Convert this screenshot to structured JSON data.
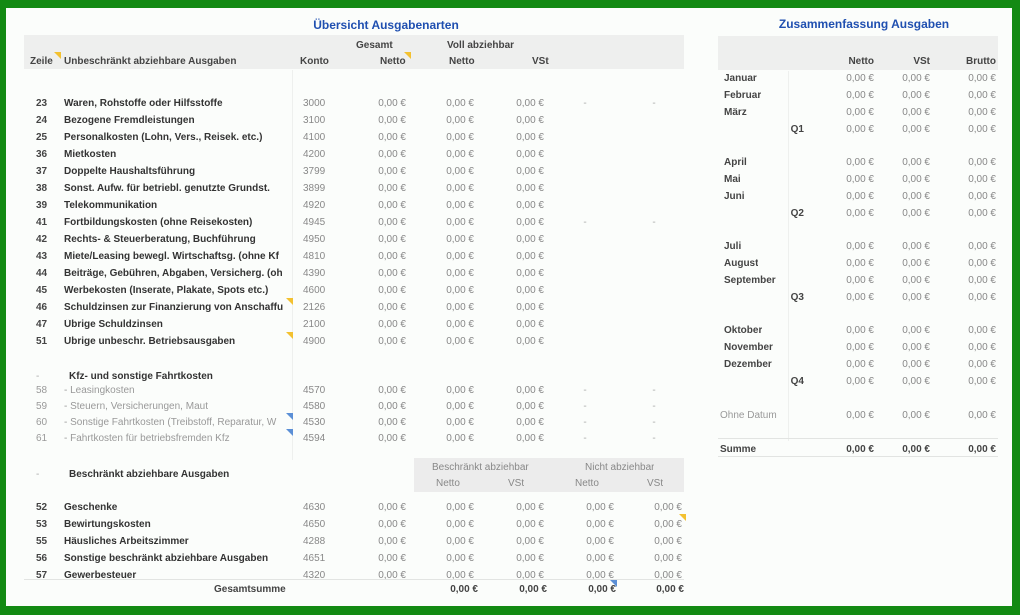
{
  "left": {
    "title": "Übersicht Ausgabenarten",
    "headers": {
      "zeile": "Zeile",
      "category": "Unbeschränkt abziehbare Ausgaben",
      "konto": "Konto",
      "gesamt": "Gesamt",
      "gesamt_netto": "Netto",
      "voll": "Voll abziehbar",
      "voll_netto": "Netto",
      "voll_vst": "VSt"
    },
    "unbeschraenkt_rows": [
      {
        "zeile": "23",
        "label": "Waren, Rohstoffe oder Hilfsstoffe",
        "konto": "3000",
        "gesamt": "0,00 €",
        "netto": "0,00 €",
        "vst": "0,00 €",
        "d1": "-",
        "d2": "-"
      },
      {
        "zeile": "24",
        "label": "Bezogene Fremdleistungen",
        "konto": "3100",
        "gesamt": "0,00 €",
        "netto": "0,00 €",
        "vst": "0,00 €",
        "d1": "",
        "d2": ""
      },
      {
        "zeile": "25",
        "label": "Personalkosten (Lohn, Vers., Reisek. etc.)",
        "konto": "4100",
        "gesamt": "0,00 €",
        "netto": "0,00 €",
        "vst": "0,00 €",
        "d1": "",
        "d2": ""
      },
      {
        "zeile": "36",
        "label": "Mietkosten",
        "konto": "4200",
        "gesamt": "0,00 €",
        "netto": "0,00 €",
        "vst": "0,00 €",
        "d1": "",
        "d2": ""
      },
      {
        "zeile": "37",
        "label": "Doppelte Haushaltsführung",
        "konto": "3799",
        "gesamt": "0,00 €",
        "netto": "0,00 €",
        "vst": "0,00 €",
        "d1": "",
        "d2": ""
      },
      {
        "zeile": "38",
        "label": "Sonst. Aufw. für betriebl. genutzte Grundst.",
        "konto": "3899",
        "gesamt": "0,00 €",
        "netto": "0,00 €",
        "vst": "0,00 €",
        "d1": "",
        "d2": ""
      },
      {
        "zeile": "39",
        "label": "Telekommunikation",
        "konto": "4920",
        "gesamt": "0,00 €",
        "netto": "0,00 €",
        "vst": "0,00 €",
        "d1": "",
        "d2": ""
      },
      {
        "zeile": "41",
        "label": "Fortbildungskosten (ohne Reisekosten)",
        "konto": "4945",
        "gesamt": "0,00 €",
        "netto": "0,00 €",
        "vst": "0,00 €",
        "d1": "-",
        "d2": "-"
      },
      {
        "zeile": "42",
        "label": "Rechts- & Steuerberatung, Buchführung",
        "konto": "4950",
        "gesamt": "0,00 €",
        "netto": "0,00 €",
        "vst": "0,00 €",
        "d1": "",
        "d2": ""
      },
      {
        "zeile": "43",
        "label": "Miete/Leasing bewegl. Wirtschaftsg. (ohne Kf",
        "konto": "4810",
        "gesamt": "0,00 €",
        "netto": "0,00 €",
        "vst": "0,00 €",
        "d1": "",
        "d2": ""
      },
      {
        "zeile": "44",
        "label": "Beiträge, Gebühren, Abgaben, Versicherg. (oh",
        "konto": "4390",
        "gesamt": "0,00 €",
        "netto": "0,00 €",
        "vst": "0,00 €",
        "d1": "",
        "d2": ""
      },
      {
        "zeile": "45",
        "label": "Werbekosten (Inserate, Plakate, Spots etc.)",
        "konto": "4600",
        "gesamt": "0,00 €",
        "netto": "0,00 €",
        "vst": "0,00 €",
        "d1": "",
        "d2": ""
      },
      {
        "zeile": "46",
        "label": "Schuldzinsen zur Finanzierung von Anschaffu",
        "konto": "2126",
        "gesamt": "0,00 €",
        "netto": "0,00 €",
        "vst": "0,00 €",
        "d1": "",
        "d2": ""
      },
      {
        "zeile": "47",
        "label": "Übrige Schuldzinsen",
        "konto": "2100",
        "gesamt": "0,00 €",
        "netto": "0,00 €",
        "vst": "0,00 €",
        "d1": "",
        "d2": ""
      },
      {
        "zeile": "51",
        "label": "Übrige unbeschr. Betriebsausgaben",
        "konto": "4900",
        "gesamt": "0,00 €",
        "netto": "0,00 €",
        "vst": "0,00 €",
        "d1": "",
        "d2": ""
      }
    ],
    "kfz_section": {
      "marker": "-",
      "label": "Kfz- und sonstige Fahrtkosten",
      "rows": [
        {
          "zeile": "58",
          "label": "- Leasingkosten",
          "konto": "4570",
          "gesamt": "0,00 €",
          "netto": "0,00 €",
          "vst": "0,00 €",
          "d1": "-",
          "d2": "-"
        },
        {
          "zeile": "59",
          "label": "- Steuern, Versicherungen, Maut",
          "konto": "4580",
          "gesamt": "0,00 €",
          "netto": "0,00 €",
          "vst": "0,00 €",
          "d1": "-",
          "d2": "-"
        },
        {
          "zeile": "60",
          "label": "- Sonstige Fahrtkosten (Treibstoff, Reparatur, W",
          "konto": "4530",
          "gesamt": "0,00 €",
          "netto": "0,00 €",
          "vst": "0,00 €",
          "d1": "-",
          "d2": "-"
        },
        {
          "zeile": "61",
          "label": "- Fahrtkosten für betriebsfremden Kfz",
          "konto": "4594",
          "gesamt": "0,00 €",
          "netto": "0,00 €",
          "vst": "0,00 €",
          "d1": "-",
          "d2": "-"
        }
      ]
    },
    "beschraenkt_section": {
      "marker": "-",
      "label": "Beschränkt abziehbare Ausgaben",
      "group1": "Beschränkt abziehbar",
      "group2": "Nicht abziehbar",
      "sub_netto1": "Netto",
      "sub_vst1": "VSt",
      "sub_netto2": "Netto",
      "sub_vst2": "VSt",
      "rows": [
        {
          "zeile": "52",
          "label": "Geschenke",
          "konto": "4630",
          "gesamt": "0,00 €",
          "b_netto": "0,00 €",
          "b_vst": "0,00 €",
          "n_netto": "0,00 €",
          "n_vst": "0,00 €"
        },
        {
          "zeile": "53",
          "label": "Bewirtungskosten",
          "konto": "4650",
          "gesamt": "0,00 €",
          "b_netto": "0,00 €",
          "b_vst": "0,00 €",
          "n_netto": "0,00 €",
          "n_vst": "0,00 €"
        },
        {
          "zeile": "55",
          "label": "Häusliches Arbeitszimmer",
          "konto": "4288",
          "gesamt": "0,00 €",
          "b_netto": "0,00 €",
          "b_vst": "0,00 €",
          "n_netto": "0,00 €",
          "n_vst": "0,00 €"
        },
        {
          "zeile": "56",
          "label": "Sonstige beschränkt abziehbare Ausgaben",
          "konto": "4651",
          "gesamt": "0,00 €",
          "b_netto": "0,00 €",
          "b_vst": "0,00 €",
          "n_netto": "0,00 €",
          "n_vst": "0,00 €"
        },
        {
          "zeile": "57",
          "label": "Gewerbesteuer",
          "konto": "4320",
          "gesamt": "0,00 €",
          "b_netto": "0,00 €",
          "b_vst": "0,00 €",
          "n_netto": "0,00 €",
          "n_vst": "0,00 €"
        }
      ]
    },
    "gesamtsumme": {
      "label": "Gesamtsumme",
      "b_netto": "0,00 €",
      "b_vst": "0,00 €",
      "n_netto": "0,00 €",
      "n_vst": "0,00 €"
    }
  },
  "right": {
    "title": "Zusammenfassung Ausgaben",
    "headers": {
      "netto": "Netto",
      "vst": "VSt",
      "brutto": "Brutto"
    },
    "groups": [
      {
        "months": [
          {
            "label": "Januar",
            "netto": "0,00 €",
            "vst": "0,00 €",
            "brutto": "0,00 €"
          },
          {
            "label": "Februar",
            "netto": "0,00 €",
            "vst": "0,00 €",
            "brutto": "0,00 €"
          },
          {
            "label": "März",
            "netto": "0,00 €",
            "vst": "0,00 €",
            "brutto": "0,00 €"
          }
        ],
        "quarter": {
          "label": "Q1",
          "netto": "0,00 €",
          "vst": "0,00 €",
          "brutto": "0,00 €"
        }
      },
      {
        "months": [
          {
            "label": "April",
            "netto": "0,00 €",
            "vst": "0,00 €",
            "brutto": "0,00 €"
          },
          {
            "label": "Mai",
            "netto": "0,00 €",
            "vst": "0,00 €",
            "brutto": "0,00 €"
          },
          {
            "label": "Juni",
            "netto": "0,00 €",
            "vst": "0,00 €",
            "brutto": "0,00 €"
          }
        ],
        "quarter": {
          "label": "Q2",
          "netto": "0,00 €",
          "vst": "0,00 €",
          "brutto": "0,00 €"
        }
      },
      {
        "months": [
          {
            "label": "Juli",
            "netto": "0,00 €",
            "vst": "0,00 €",
            "brutto": "0,00 €"
          },
          {
            "label": "August",
            "netto": "0,00 €",
            "vst": "0,00 €",
            "brutto": "0,00 €"
          },
          {
            "label": "September",
            "netto": "0,00 €",
            "vst": "0,00 €",
            "brutto": "0,00 €"
          }
        ],
        "quarter": {
          "label": "Q3",
          "netto": "0,00 €",
          "vst": "0,00 €",
          "brutto": "0,00 €"
        }
      },
      {
        "months": [
          {
            "label": "Oktober",
            "netto": "0,00 €",
            "vst": "0,00 €",
            "brutto": "0,00 €"
          },
          {
            "label": "November",
            "netto": "0,00 €",
            "vst": "0,00 €",
            "brutto": "0,00 €"
          },
          {
            "label": "Dezember",
            "netto": "0,00 €",
            "vst": "0,00 €",
            "brutto": "0,00 €"
          }
        ],
        "quarter": {
          "label": "Q4",
          "netto": "0,00 €",
          "vst": "0,00 €",
          "brutto": "0,00 €"
        }
      }
    ],
    "ohne_datum": {
      "label": "Ohne Datum",
      "netto": "0,00 €",
      "vst": "0,00 €",
      "brutto": "0,00 €"
    },
    "summe": {
      "label": "Summe",
      "netto": "0,00 €",
      "vst": "0,00 €",
      "brutto": "0,00 €"
    }
  },
  "colors": {
    "frame": "#138a13",
    "title": "#1f4fb0",
    "header_band": "#eeefee",
    "comment_marker": "#f3c130",
    "comment_marker_blue": "#5b8fd6"
  }
}
